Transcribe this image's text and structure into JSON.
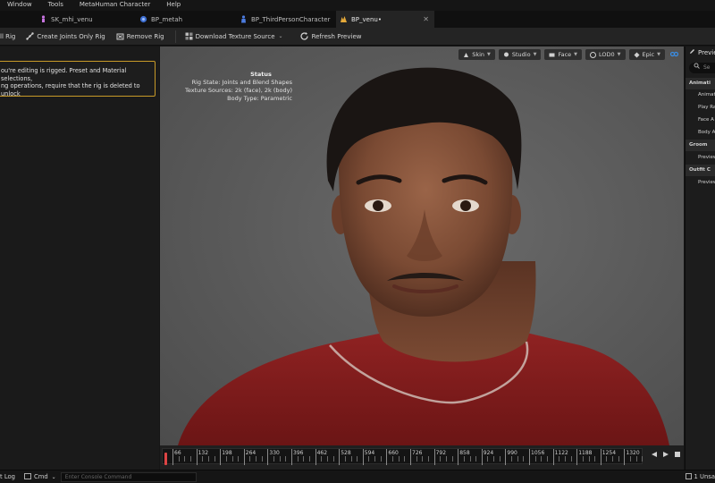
{
  "menu": [
    "Window",
    "Tools",
    "MetaHuman Character",
    "Help"
  ],
  "tabs": [
    {
      "label": "SK_mhi_venu",
      "active": false
    },
    {
      "label": "BP_metah",
      "active": false
    },
    {
      "label": "BP_ThirdPersonCharacter",
      "active": false
    },
    {
      "label": "BP_venu•",
      "active": true
    }
  ],
  "toolbar": {
    "remove_all_rig": "ll Rig",
    "create_joints_only_rig": "Create Joints Only Rig",
    "remove_rig": "Remove Rig",
    "download_texture_source": "Download Texture Source",
    "refresh_preview": "Refresh Preview"
  },
  "warning": {
    "line1": "ou're editing is rigged. Preset and Material selections,",
    "line2": "ng operations, require that the rig is deleted to unlock"
  },
  "viewport": {
    "status_title": "Status",
    "rig_state": "Rig State: Joints and Blend Shapes",
    "texture_sources": "Texture Sources: 2k (face), 2k (body)",
    "body_type": "Body Type: Parametric",
    "tools": [
      "Skin",
      "Studio",
      "Face",
      "LOD0",
      "Epic"
    ]
  },
  "timeline": {
    "labels": [
      "66",
      "132",
      "198",
      "264",
      "330",
      "396",
      "462",
      "528",
      "594",
      "660",
      "726",
      "792",
      "858",
      "924",
      "990",
      "1056",
      "1122",
      "1188",
      "1254",
      "1320"
    ]
  },
  "right_panel": {
    "title": "Previe",
    "search_placeholder": "Se",
    "rows": [
      {
        "label": "Animati",
        "kind": "cat"
      },
      {
        "label": "Animat",
        "kind": "sub"
      },
      {
        "label": "Play Ra",
        "kind": "sub"
      },
      {
        "label": "Face A",
        "kind": "sub"
      },
      {
        "label": "Body A",
        "kind": "sub"
      },
      {
        "label": "Groom",
        "kind": "cat"
      },
      {
        "label": "Preview",
        "kind": "sub"
      },
      {
        "label": "Outfit C",
        "kind": "cat"
      },
      {
        "label": "Preview",
        "kind": "sub"
      }
    ]
  },
  "bottom": {
    "output_log": "t Log",
    "cmd": "Cmd",
    "console_placeholder": "Enter Console Command",
    "unsaved": "1 Unsa"
  },
  "colors": {
    "warning_border": "#c89a28",
    "active_tab_bg": "#242424",
    "viewport_bg": "#5c5c5c",
    "shirt": "#8a1e1e"
  }
}
